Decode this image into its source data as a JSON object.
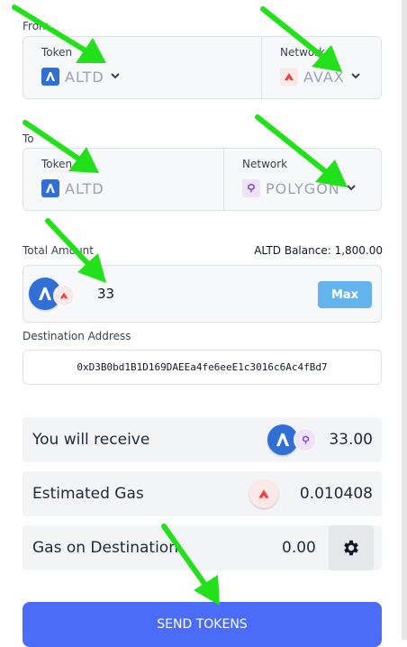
{
  "from": {
    "label": "From",
    "token": {
      "label": "Token",
      "value": "ALTD"
    },
    "network": {
      "label": "Network",
      "value": "AVAX"
    }
  },
  "to": {
    "label": "To",
    "token": {
      "label": "Token",
      "value": "ALTD"
    },
    "network": {
      "label": "Network",
      "value": "POLYGON"
    }
  },
  "amount": {
    "label": "Total Amount",
    "balance": "ALTD Balance: 1,800.00",
    "value": "33",
    "max_label": "Max"
  },
  "destination": {
    "label": "Destination Address",
    "value": "0xD3B0bd1B1D169DAEEa4fe6eeE1c3016c6Ac4fBd7"
  },
  "summary": {
    "receive": {
      "label": "You will receive",
      "value": "33.00"
    },
    "gas": {
      "label": "Estimated Gas",
      "value": "0.010408"
    },
    "dest_gas": {
      "label": "Gas on Destination",
      "value": "0.00"
    }
  },
  "send_label": "SEND TOKENS",
  "colors": {
    "accent": "#4a6cf7",
    "token_blue": "#2f6fd6",
    "avax_red": "#e84142",
    "polygon_purple": "#8247e5",
    "arrow_green": "#22e01a"
  },
  "icons": [
    "altd-token-icon",
    "avax-icon",
    "polygon-icon",
    "chevron-down-icon",
    "gear-icon"
  ]
}
